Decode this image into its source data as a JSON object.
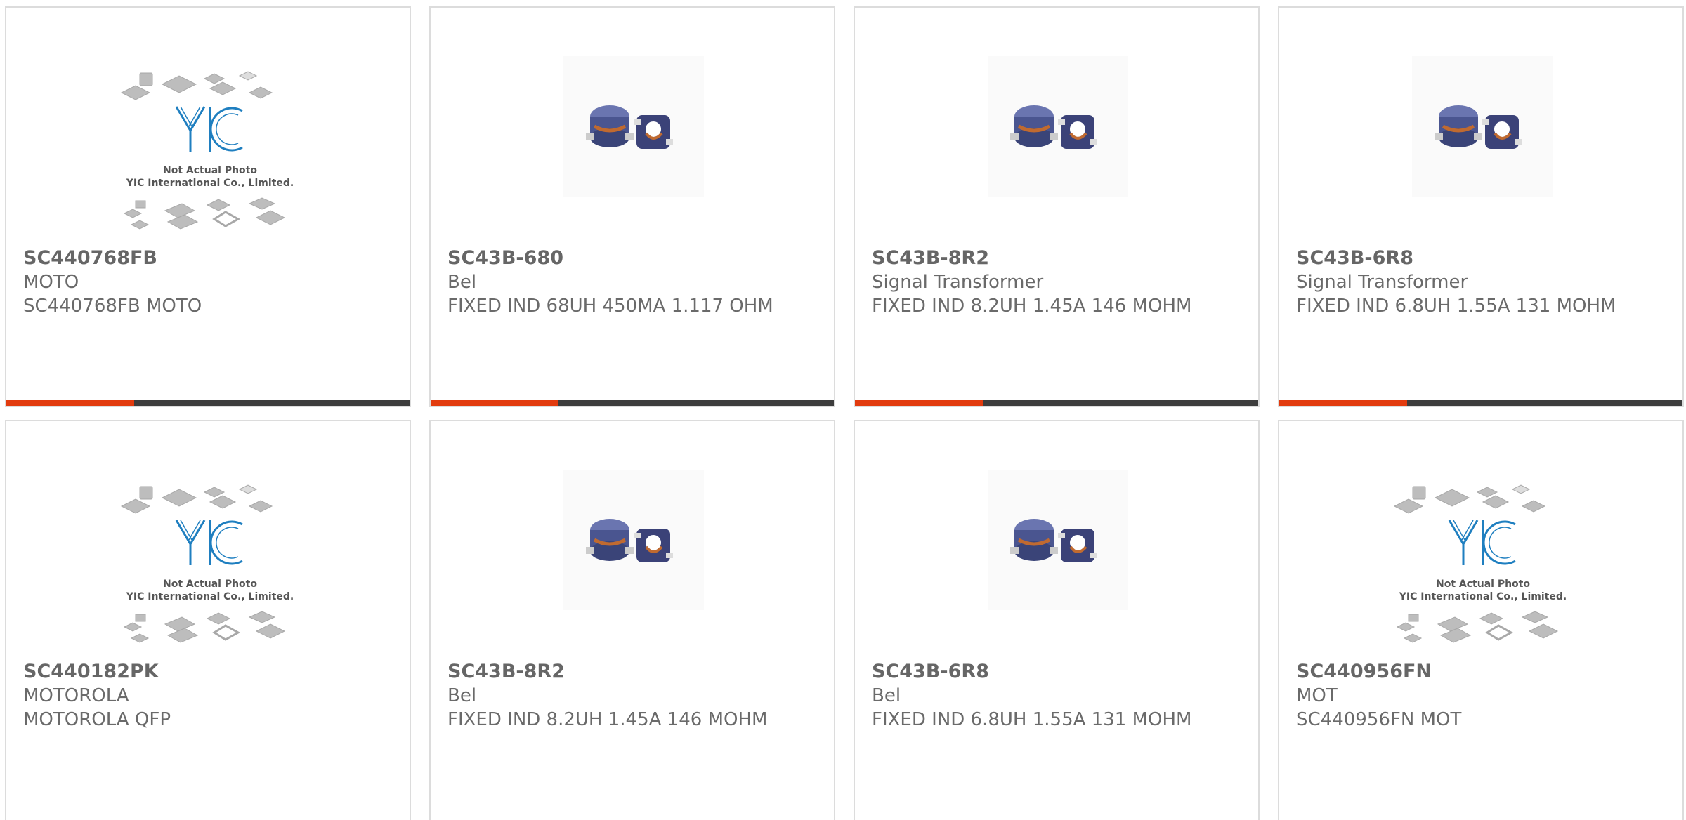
{
  "products": [
    {
      "pn": "SC440768FB",
      "mfr": "MOTO",
      "desc": "SC440768FB MOTO",
      "image": "yic-placeholder",
      "placeholder_line1": "Not Actual Photo",
      "placeholder_line2": "YIC International Co., Limited."
    },
    {
      "pn": "SC43B-680",
      "mfr": "Bel",
      "desc": "FIXED IND 68UH 450MA 1.117 OHM",
      "image": "inductor-photo"
    },
    {
      "pn": "SC43B-8R2",
      "mfr": "Signal Transformer",
      "desc": "FIXED IND 8.2UH 1.45A 146 MOHM",
      "image": "inductor-photo"
    },
    {
      "pn": "SC43B-6R8",
      "mfr": "Signal Transformer",
      "desc": "FIXED IND 6.8UH 1.55A 131 MOHM",
      "image": "inductor-photo"
    },
    {
      "pn": "SC440182PK",
      "mfr": "MOTOROLA",
      "desc": "MOTOROLA QFP",
      "image": "yic-placeholder",
      "placeholder_line1": "Not Actual Photo",
      "placeholder_line2": "YIC International Co., Limited."
    },
    {
      "pn": "SC43B-8R2",
      "mfr": "Bel",
      "desc": "FIXED IND 8.2UH 1.45A 146 MOHM",
      "image": "inductor-photo"
    },
    {
      "pn": "SC43B-6R8",
      "mfr": "Bel",
      "desc": "FIXED IND 6.8UH 1.55A 131 MOHM",
      "image": "inductor-photo"
    },
    {
      "pn": "SC440956FN",
      "mfr": "MOT",
      "desc": "SC440956FN MOT",
      "image": "yic-placeholder",
      "placeholder_line1": "Not Actual Photo",
      "placeholder_line2": "YIC International Co., Limited."
    }
  ],
  "colors": {
    "accent": "#e23b0e",
    "bar": "#3d3d3d",
    "text": "#6a6a6a",
    "logo": "#1f7fc0"
  }
}
